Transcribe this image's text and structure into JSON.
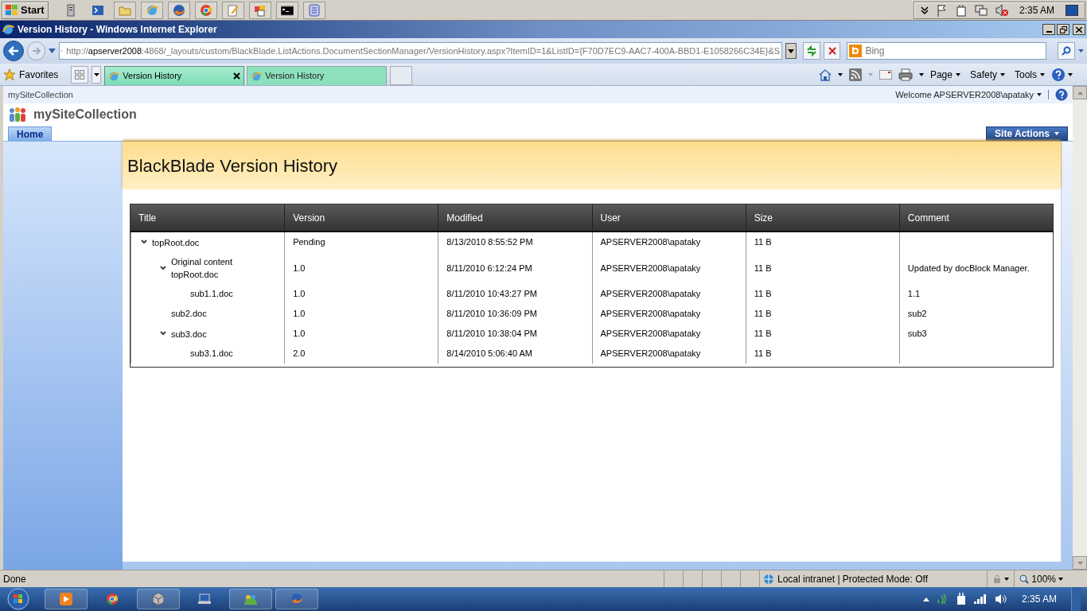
{
  "top_taskbar": {
    "start": "Start",
    "clock": "2:35 AM"
  },
  "browser": {
    "title": "Version History - Windows Internet Explorer",
    "address": {
      "scheme": "http://",
      "host": "apserver2008",
      "path": ":4868/_layouts/custom/BlackBlade.ListActions.DocumentSectionManager/VersionHistory.aspx?ItemID=1&ListID={F70D7EC9-AAC7-400A-BBD1-E1058266C34E}&S"
    },
    "search": {
      "placeholder": "Bing"
    },
    "favorites": "Favorites",
    "tabs": [
      {
        "label": "Version History",
        "selected": true
      },
      {
        "label": "Version History",
        "selected": false
      }
    ],
    "command_menus": [
      "Page",
      "Safety",
      "Tools"
    ],
    "status": "Done",
    "zone": "Local intranet | Protected Mode: Off",
    "zoom": "100%"
  },
  "site": {
    "breadcrumb": "mySiteCollection",
    "welcome": "Welcome APSERVER2008\\apataky",
    "title": "mySiteCollection",
    "nav": [
      {
        "label": "Home",
        "selected": true
      }
    ],
    "site_actions": "Site Actions"
  },
  "page": {
    "heading": "BlackBlade Version History",
    "table": {
      "columns": [
        "Title",
        "Version",
        "Modified",
        "User",
        "Size",
        "Comment"
      ],
      "rows": [
        {
          "title": "topRoot.doc",
          "version": "Pending",
          "modified": "8/13/2010 8:55:52 PM",
          "user": "APSERVER2008\\apataky",
          "size": "11 B",
          "expanded": true,
          "children": [
            {
              "title": "Original content topRoot.doc",
              "version": "1.0",
              "modified": "8/11/2010 6:12:24 PM",
              "user": "APSERVER2008\\apataky",
              "size": "11 B",
              "comment": "Updated by docBlock Manager.",
              "expanded": true,
              "children": [
                {
                  "title": "sub1.1.doc",
                  "version": "1.0",
                  "modified": "8/11/2010 10:43:27 PM",
                  "user": "APSERVER2008\\apataky",
                  "size": "11 B",
                  "comment": "1.1"
                }
              ]
            },
            {
              "title": "sub2.doc",
              "version": "1.0",
              "modified": "8/11/2010 10:36:09 PM",
              "user": "APSERVER2008\\apataky",
              "size": "11 B",
              "comment": "sub2"
            },
            {
              "title": "sub3.doc",
              "version": "1.0",
              "modified": "8/11/2010 10:38:04 PM",
              "user": "APSERVER2008\\apataky",
              "size": "11 B",
              "comment": "sub3",
              "expanded": true,
              "children": [
                {
                  "title": "sub3.1.doc",
                  "version": "2.0",
                  "modified": "8/14/2010 5:06:40 AM",
                  "user": "APSERVER2008\\apataky",
                  "size": "11 B"
                }
              ]
            }
          ]
        }
      ]
    }
  },
  "bottom_taskbar": {
    "clock": "2:35 AM"
  }
}
